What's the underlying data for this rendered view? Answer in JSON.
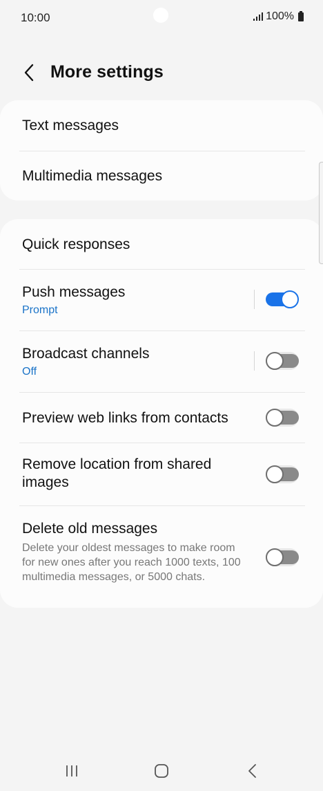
{
  "status_bar": {
    "time": "10:00",
    "battery": "100%"
  },
  "header": {
    "title": "More settings",
    "back_icon": "back-arrow-icon"
  },
  "card1": {
    "items": [
      {
        "label": "Text messages"
      },
      {
        "label": "Multimedia messages"
      }
    ]
  },
  "card2": {
    "items": [
      {
        "label": "Quick responses"
      },
      {
        "label": "Push messages",
        "sub": "Prompt",
        "toggle": true
      },
      {
        "label": "Broadcast channels",
        "sub": "Off",
        "toggle": false
      },
      {
        "label": "Preview web links from contacts",
        "toggle": false
      },
      {
        "label": "Remove location from shared images",
        "toggle": false
      },
      {
        "label": "Delete old messages",
        "desc": "Delete your oldest messages to make room for new ones after you reach 1000 texts, 100 multimedia messages, or 5000 chats.",
        "toggle": false
      }
    ]
  },
  "colors": {
    "accent": "#1a73e8",
    "sub_text": "#1a73c8",
    "background": "#f4f4f4",
    "card": "#fcfcfc"
  },
  "nav_bar": {
    "icons": [
      "recents-icon",
      "home-icon",
      "back-icon"
    ]
  }
}
